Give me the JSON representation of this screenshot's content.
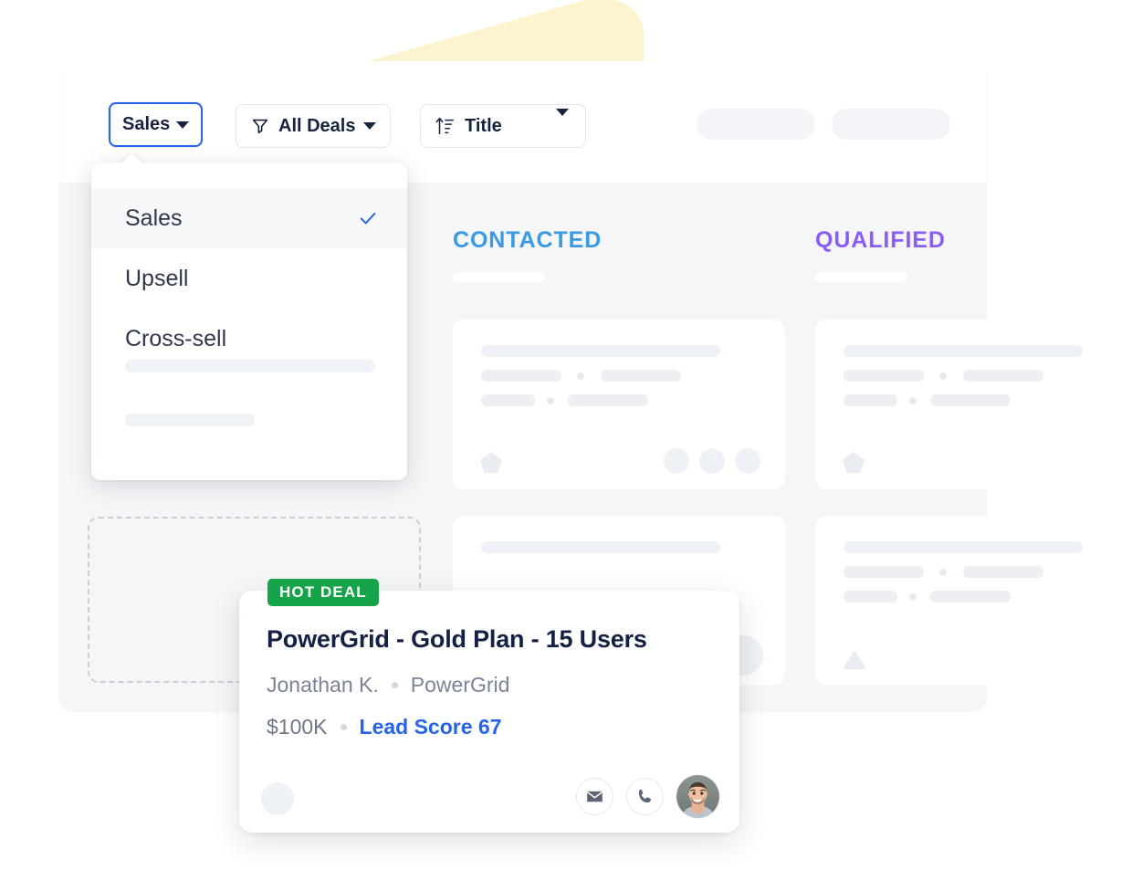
{
  "toolbar": {
    "pipeline_button": {
      "label": "Sales",
      "icon": "chevron-down-icon"
    },
    "filter_button": {
      "label": "All Deals",
      "icon": "filter-funnel-icon",
      "caret": "chevron-down-icon"
    },
    "sort_button": {
      "label": "Title",
      "icon": "sort-ascending-icon",
      "caret": "chevron-down-icon"
    },
    "placeholder_pills": [
      "",
      ""
    ]
  },
  "dropdown": {
    "items": [
      {
        "label": "Sales",
        "selected": true
      },
      {
        "label": "Upsell",
        "selected": false
      },
      {
        "label": "Cross-sell",
        "selected": false
      }
    ],
    "check_icon": "check-icon",
    "skeleton_rows": 2
  },
  "board": {
    "columns": [
      {
        "title": "CONTACTED",
        "color": "#3b9ae1",
        "cards": 2
      },
      {
        "title": "QUALIFIED",
        "color": "#8b5cf6",
        "cards": 2
      }
    ],
    "dropzone": {
      "label": ""
    }
  },
  "deal_card": {
    "badge": "HOT DEAL",
    "badge_color": "#16a34a",
    "title": "PowerGrid - Gold Plan - 15 Users",
    "contact": "Jonathan K.",
    "company": "PowerGrid",
    "amount": "$100K",
    "lead_score": "Lead Score 67",
    "lead_score_color": "#2563eb",
    "actions": [
      {
        "name": "email-action",
        "icon": "envelope-icon"
      },
      {
        "name": "call-action",
        "icon": "phone-icon"
      }
    ],
    "avatar": "owner-avatar"
  },
  "decor": {
    "wedge_color": "#fdf4cf"
  }
}
